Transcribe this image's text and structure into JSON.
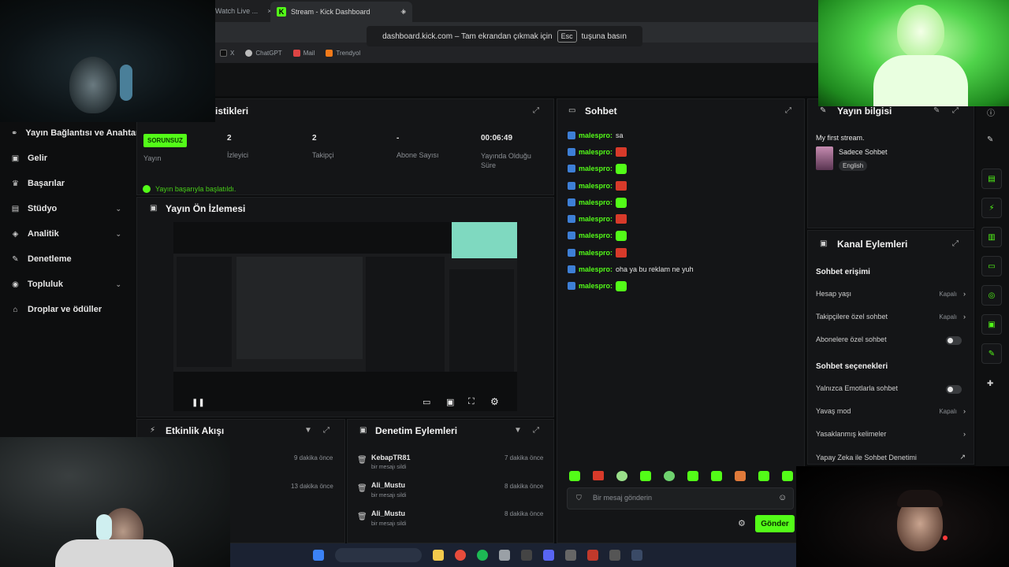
{
  "browser": {
    "tabs": [
      {
        "label": "Watch Live ..."
      },
      {
        "label": "Stream - Kick Dashboard"
      }
    ],
    "new_tab": "+",
    "close_glyph": "×",
    "fullscreen_notice_prefix": "dashboard.kick.com – Tam ekrandan çıkmak için",
    "fullscreen_key": "Esc",
    "fullscreen_notice_suffix": "tuşuna basın",
    "bookmarks": [
      "X",
      "ChatGPT",
      "Mail",
      "Trendyol"
    ]
  },
  "sidebar": {
    "items": [
      {
        "label": "Yayın Bağlantısı ve Anahtar",
        "icon": "link-icon"
      },
      {
        "label": "Gelir",
        "icon": "money-icon"
      },
      {
        "label": "Başarılar",
        "icon": "trophy-icon"
      },
      {
        "label": "Stüdyo",
        "icon": "studio-icon",
        "expandable": true
      },
      {
        "label": "Analitik",
        "icon": "chart-icon",
        "expandable": true
      },
      {
        "label": "Denetleme",
        "icon": "wrench-icon"
      },
      {
        "label": "Topluluk",
        "icon": "community-icon",
        "expandable": true
      },
      {
        "label": "Droplar ve ödüller",
        "icon": "gift-icon"
      }
    ]
  },
  "stats": {
    "title": "istikleri",
    "stream_badge": "SORUNSUZ",
    "stream_label": "Yayın",
    "viewers_value": "2",
    "viewers_label": "İzleyici",
    "followers_value": "2",
    "followers_label": "Takipçi",
    "subs_value": "-",
    "subs_label": "Abone Sayısı",
    "uptime_value": "00:06:49",
    "uptime_label": "Yayında Olduğu Süre",
    "success_message": "Yayın başarıyla başlatıldı."
  },
  "preview": {
    "title": "Yayın Ön İzlemesi"
  },
  "activity": {
    "title": "Etkinlik Akışı",
    "items": [
      {
        "time": "9 dakika önce"
      },
      {
        "time": "13 dakika önce"
      }
    ]
  },
  "moderation": {
    "title": "Denetim Eylemleri",
    "items": [
      {
        "user": "KebapTR81",
        "action": "bir mesajı sildi",
        "time": "7 dakika önce"
      },
      {
        "user": "Ali_Mustu",
        "action": "bir mesajı sildi",
        "time": "8 dakika önce"
      },
      {
        "user": "Ali_Mustu",
        "action": "bir mesajı sildi",
        "time": "8 dakika önce"
      }
    ]
  },
  "chat": {
    "title": "Sohbet",
    "messages": [
      {
        "user": "malespro:",
        "text": "sa",
        "emote": ""
      },
      {
        "user": "malespro:",
        "text": "",
        "emote": "red"
      },
      {
        "user": "malespro:",
        "text": "",
        "emote": "green"
      },
      {
        "user": "malespro:",
        "text": "",
        "emote": "red"
      },
      {
        "user": "malespro:",
        "text": "",
        "emote": "green"
      },
      {
        "user": "malespro:",
        "text": "",
        "emote": "red"
      },
      {
        "user": "malespro:",
        "text": "",
        "emote": "green"
      },
      {
        "user": "malespro:",
        "text": "",
        "emote": "red"
      },
      {
        "user": "malespro:",
        "text": "oha ya bu reklam ne yuh",
        "emote": ""
      },
      {
        "user": "malespro:",
        "text": "",
        "emote": "green"
      }
    ],
    "input_placeholder": "Bir mesaj gönderin",
    "send_label": "Gönder"
  },
  "stream_info": {
    "title": "Yayın bilgisi",
    "stream_title": "My first stream.",
    "category": "Sadece Sohbet",
    "language": "English"
  },
  "channel_actions": {
    "title": "Kanal Eylemleri",
    "chat_access_heading": "Sohbet erişimi",
    "account_age_label": "Hesap yaşı",
    "account_age_value": "Kapalı",
    "followers_only_label": "Takipçilere özel sohbet",
    "followers_only_value": "Kapalı",
    "subs_only_label": "Abonelere özel sohbet",
    "chat_options_heading": "Sohbet seçenekleri",
    "emotes_only_label": "Yalnızca Emotlarla sohbet",
    "slow_mode_label": "Yavaş mod",
    "slow_mode_value": "Kapalı",
    "banned_words_label": "Yasaklanmış kelimeler",
    "ai_moderation_label": "Yapay Zeka ile Sohbet Denetimi"
  },
  "colors": {
    "accent": "#53fc18",
    "panel": "#141517",
    "background": "#0b0c0d"
  }
}
